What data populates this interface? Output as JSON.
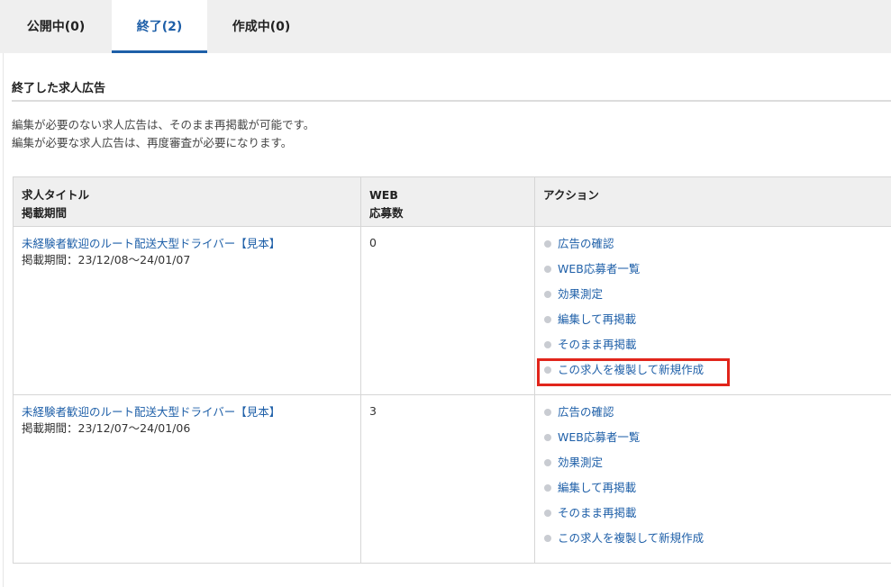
{
  "tabs": [
    {
      "label": "公開中(0)"
    },
    {
      "label": "終了(2)"
    },
    {
      "label": "作成中(0)"
    }
  ],
  "section": {
    "title": "終了した求人広告",
    "desc1": "編集が必要のない求人広告は、そのまま再掲載が可能です。",
    "desc2": "編集が必要な求人広告は、再度審査が必要になります。"
  },
  "table": {
    "headers": {
      "col1_line1": "求人タイトル",
      "col1_line2": "掲載期間",
      "col2_line1": "WEB",
      "col2_line2": "応募数",
      "col3": "アクション"
    },
    "rows": [
      {
        "title": "未経験者歓迎のルート配送大型ドライバー【見本】",
        "period": "掲載期間：23/12/08〜24/01/07",
        "web": "0",
        "actions": [
          "広告の確認",
          "WEB応募者一覧",
          "効果測定",
          "編集して再掲載",
          "そのまま再掲載",
          "この求人を複製して新規作成"
        ]
      },
      {
        "title": "未経験者歓迎のルート配送大型ドライバー【見本】",
        "period": "掲載期間：23/12/07〜24/01/06",
        "web": "3",
        "actions": [
          "広告の確認",
          "WEB応募者一覧",
          "効果測定",
          "編集して再掲載",
          "そのまま再掲載",
          "この求人を複製して新規作成"
        ]
      }
    ]
  },
  "colors": {
    "link": "#1e5fa8",
    "highlight": "#e1251b",
    "tab_bg": "#efefef"
  }
}
